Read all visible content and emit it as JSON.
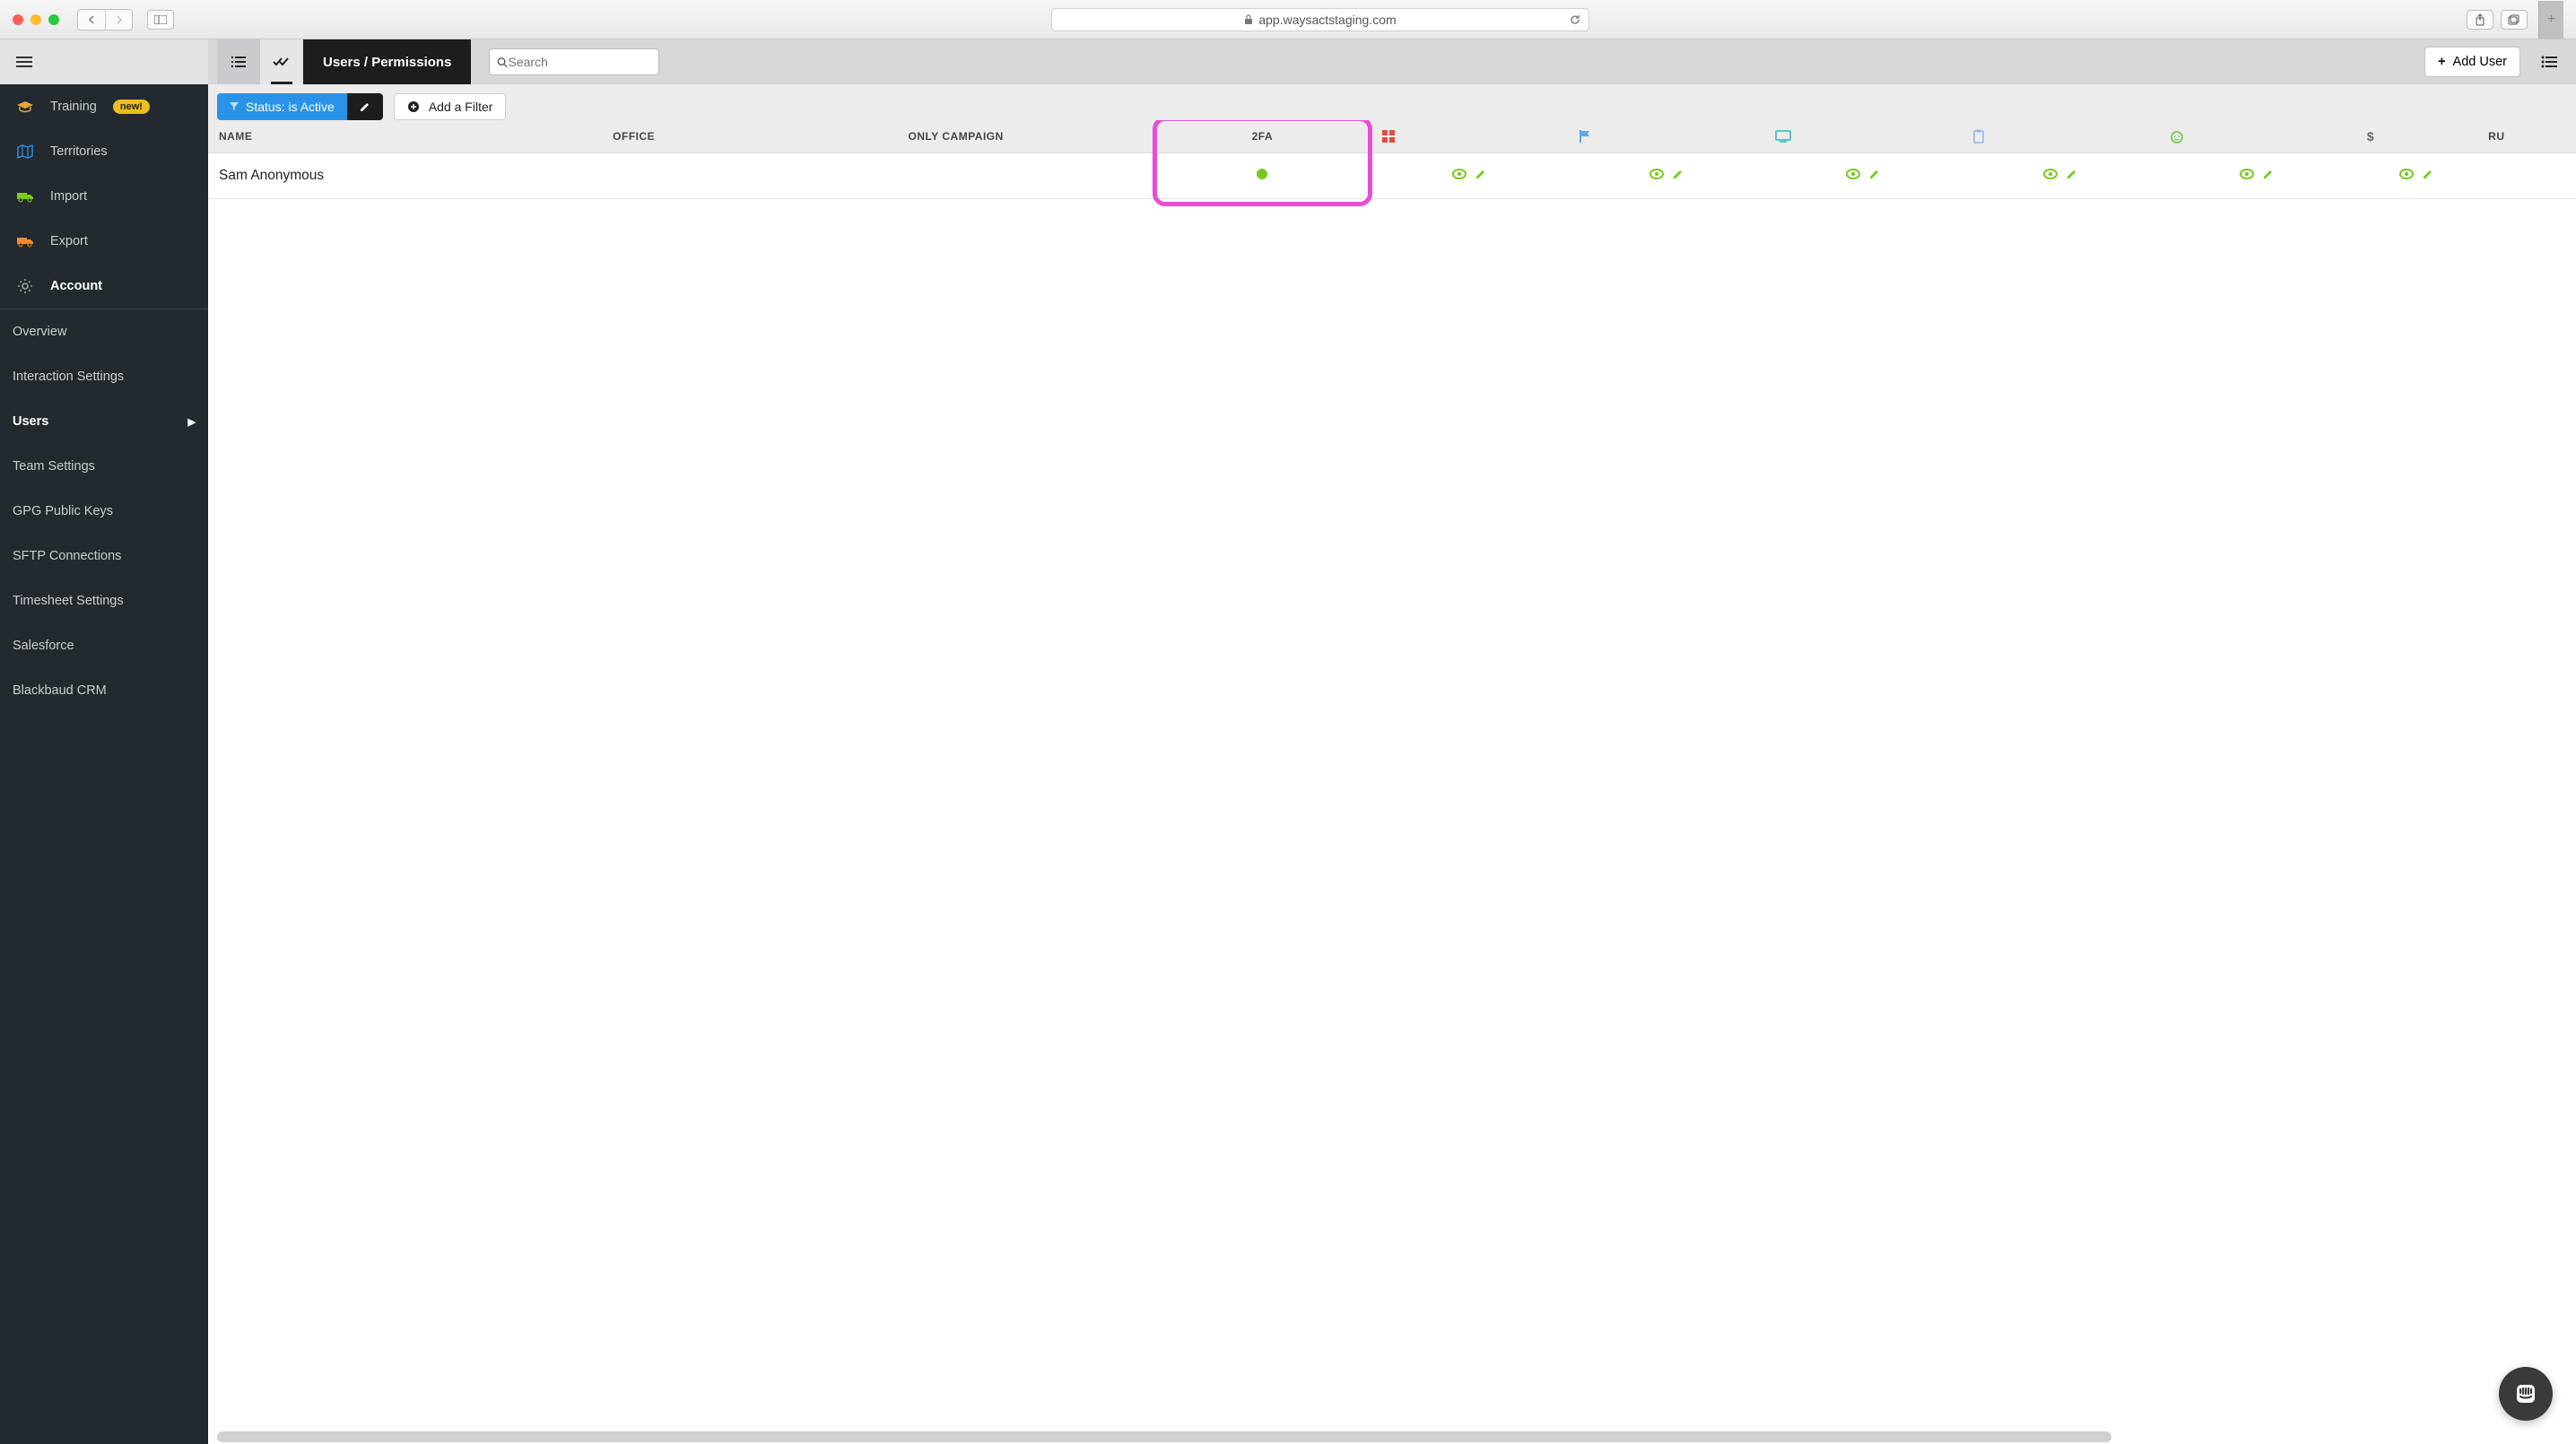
{
  "browser": {
    "url": "app.waysactstaging.com"
  },
  "sidebar": {
    "primary": [
      {
        "label": "Training",
        "icon": "graduation-cap-icon",
        "badge": "new!",
        "iconColor": "#e8a836"
      },
      {
        "label": "Territories",
        "icon": "map-icon",
        "iconColor": "#2a93e8"
      },
      {
        "label": "Import",
        "icon": "truck-in-icon",
        "iconColor": "#7bc91f"
      },
      {
        "label": "Export",
        "icon": "truck-out-icon",
        "iconColor": "#f08a32"
      },
      {
        "label": "Account",
        "icon": "gear-icon",
        "iconColor": "#9aa0a4",
        "active": true
      }
    ],
    "secondary": [
      {
        "label": "Overview"
      },
      {
        "label": "Interaction Settings"
      },
      {
        "label": "Users",
        "active": true,
        "hasCaret": true
      },
      {
        "label": "Team Settings"
      },
      {
        "label": "GPG Public Keys"
      },
      {
        "label": "SFTP Connections"
      },
      {
        "label": "Timesheet Settings"
      },
      {
        "label": "Salesforce"
      },
      {
        "label": "Blackbaud CRM"
      }
    ]
  },
  "toolbar": {
    "pageTitle": "Users / Permissions",
    "searchPlaceholder": "Search",
    "addUser": "Add User"
  },
  "filters": {
    "statusLabel": "Status: is Active",
    "addFilter": "Add a Filter"
  },
  "table": {
    "columns": {
      "name": "NAME",
      "office": "OFFICE",
      "onlyCampaign": "ONLY CAMPAIGN",
      "twofa": "2FA",
      "ru": "RU"
    },
    "iconColumns": [
      {
        "name": "dashboard-icon",
        "color": "#e24a42"
      },
      {
        "name": "flag-icon",
        "color": "#5ea9e6"
      },
      {
        "name": "screen-icon",
        "color": "#59c7c0"
      },
      {
        "name": "clipboard-icon",
        "color": "#89b9ef"
      },
      {
        "name": "robot-icon",
        "color": "#83cf62"
      },
      {
        "name": "dollar-icon",
        "color": "#6a6a6a"
      }
    ],
    "rows": [
      {
        "name": "Sam Anonymous",
        "office": "",
        "onlyCampaign": "",
        "twofa": true
      }
    ]
  }
}
